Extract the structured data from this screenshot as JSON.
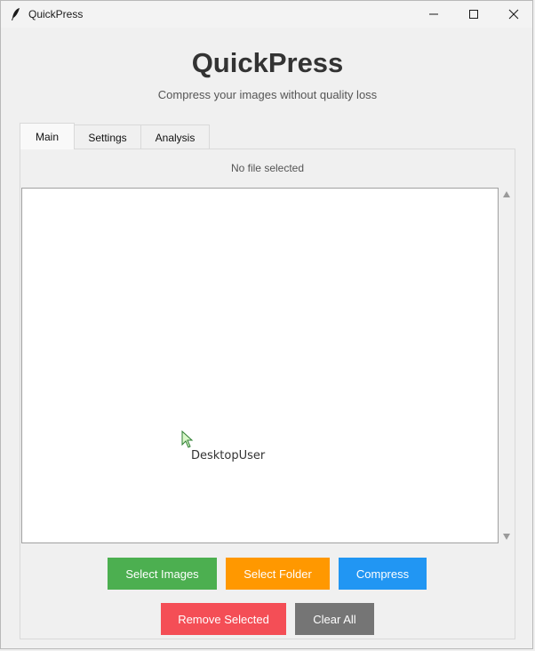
{
  "window": {
    "title": "QuickPress",
    "controls": {
      "minimize": "minimize-icon",
      "maximize": "maximize-icon",
      "close": "close-icon"
    }
  },
  "header": {
    "title": "QuickPress",
    "subtitle": "Compress your images without quality loss"
  },
  "tabs": [
    {
      "label": "Main",
      "active": true
    },
    {
      "label": "Settings",
      "active": false
    },
    {
      "label": "Analysis",
      "active": false
    }
  ],
  "main": {
    "file_status": "No file selected",
    "file_list": []
  },
  "buttons": {
    "select_images": {
      "label": "Select Images",
      "color": "#4caf50"
    },
    "select_folder": {
      "label": "Select Folder",
      "color": "#ff9800"
    },
    "compress": {
      "label": "Compress",
      "color": "#2196f3"
    },
    "remove_selected": {
      "label": "Remove Selected",
      "color": "#f44e56"
    },
    "clear_all": {
      "label": "Clear All",
      "color": "#757575"
    }
  },
  "cursor": {
    "label": "DesktopUser",
    "icon": "pointer-cursor-icon"
  }
}
